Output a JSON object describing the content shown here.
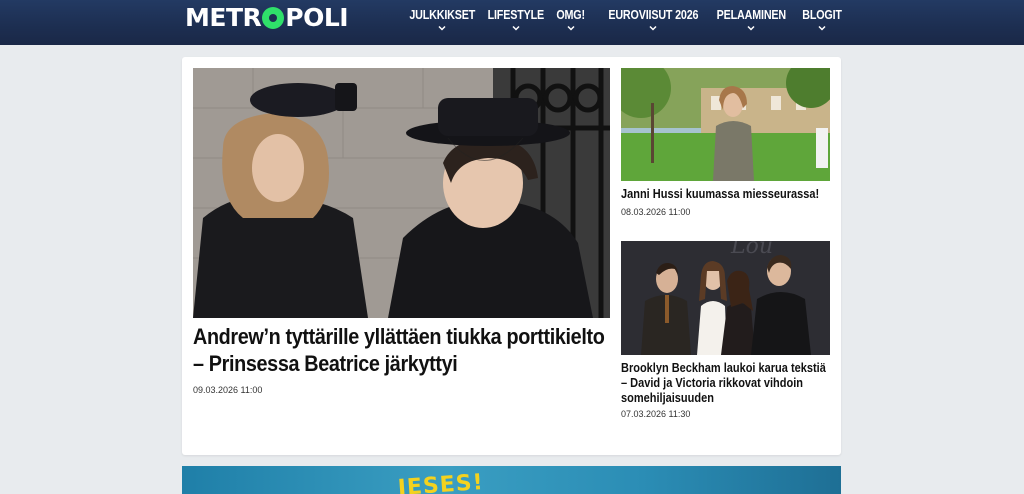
{
  "header": {
    "logo_text": "METROPOLI",
    "logo_accent": "#2fe06a",
    "nav": [
      {
        "label": "JULKKIKSET"
      },
      {
        "label": "LIFESTYLE"
      },
      {
        "label": "OMG!"
      },
      {
        "label": "EUROVIISUT 2026"
      },
      {
        "label": "PELAAMINEN"
      },
      {
        "label": "BLOGIT"
      }
    ]
  },
  "main_article": {
    "title": "Andrew’n tyttärille yllättäen tiukka porttikielto – Prinsessa Beatrice järkyttyi",
    "date": "09.03.2026 11:00"
  },
  "side_articles": [
    {
      "title": "Janni Hussi kuumassa miesseurassa!",
      "date": "08.03.2026 11:00"
    },
    {
      "title": "Brooklyn Beckham laukoi karua tekstiä – David ja Victoria rikkovat vihdoin somehiljaisuuden",
      "date": "07.03.2026 11:30"
    }
  ],
  "banner": {
    "text": "JESES!"
  }
}
